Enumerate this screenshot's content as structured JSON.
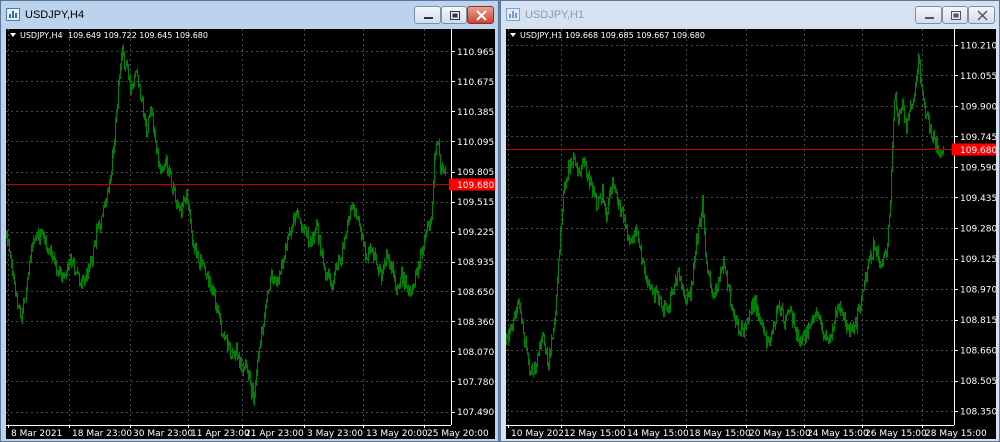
{
  "windows": [
    {
      "title": "USDJPY,H4",
      "active": true
    },
    {
      "title": "USDJPY,H1",
      "active": false
    }
  ],
  "colors": {
    "background": "#000000",
    "candles": "#008000",
    "grid": "#4d4d4d",
    "price_line": "#c00000",
    "price_label": "#ff0000",
    "text": "#ffffff"
  },
  "icons": [
    "chart-window-icon",
    "minimize-icon",
    "maximize-icon",
    "close-icon",
    "dropdown-triangle-icon"
  ],
  "chart_data": [
    {
      "type": "candlestick",
      "symbol_label": "USDJPY,H4",
      "ohlc_label": "109.649 109.722 109.645 109.680",
      "yticks": [
        "110.965",
        "110.675",
        "110.385",
        "110.095",
        "109.805",
        "109.515",
        "109.225",
        "108.935",
        "108.650",
        "108.360",
        "108.070",
        "107.780",
        "107.490"
      ],
      "ytick_values": [
        110.965,
        110.675,
        110.385,
        110.095,
        109.805,
        109.515,
        109.225,
        108.935,
        108.65,
        108.36,
        108.07,
        107.78,
        107.49
      ],
      "xticks": [
        "8 Mar 2021",
        "18 Mar 23:00",
        "30 Mar 23:00",
        "11 Apr 23:00",
        "21 Apr 23:00",
        "3 May 23:00",
        "13 May 20:00",
        "25 May 20:00"
      ],
      "current_price": 109.68,
      "current_price_label": "109.680",
      "price_path": [
        [
          0,
          109.2
        ],
        [
          5,
          108.9
        ],
        [
          10,
          108.6
        ],
        [
          15,
          108.4
        ],
        [
          20,
          108.7
        ],
        [
          25,
          109.1
        ],
        [
          35,
          109.2
        ],
        [
          45,
          109.0
        ],
        [
          55,
          108.8
        ],
        [
          65,
          108.95
        ],
        [
          75,
          108.7
        ],
        [
          85,
          108.9
        ],
        [
          90,
          109.2
        ],
        [
          100,
          109.5
        ],
        [
          105,
          109.8
        ],
        [
          110,
          110.4
        ],
        [
          113,
          110.7
        ],
        [
          116,
          110.95
        ],
        [
          120,
          110.8
        ],
        [
          125,
          110.6
        ],
        [
          130,
          110.8
        ],
        [
          135,
          110.5
        ],
        [
          140,
          110.2
        ],
        [
          145,
          110.4
        ],
        [
          150,
          110.0
        ],
        [
          155,
          109.8
        ],
        [
          160,
          109.9
        ],
        [
          165,
          109.7
        ],
        [
          170,
          109.5
        ],
        [
          175,
          109.4
        ],
        [
          180,
          109.6
        ],
        [
          185,
          109.2
        ],
        [
          190,
          109.0
        ],
        [
          195,
          108.9
        ],
        [
          200,
          108.8
        ],
        [
          205,
          108.7
        ],
        [
          210,
          108.5
        ],
        [
          215,
          108.3
        ],
        [
          220,
          108.2
        ],
        [
          225,
          108.0
        ],
        [
          230,
          108.1
        ],
        [
          235,
          107.9
        ],
        [
          240,
          108.0
        ],
        [
          245,
          107.7
        ],
        [
          248,
          107.6
        ],
        [
          252,
          108.1
        ],
        [
          256,
          108.3
        ],
        [
          260,
          108.6
        ],
        [
          265,
          108.8
        ],
        [
          270,
          108.7
        ],
        [
          275,
          108.9
        ],
        [
          280,
          109.1
        ],
        [
          285,
          109.3
        ],
        [
          290,
          109.4
        ],
        [
          295,
          109.3
        ],
        [
          300,
          109.2
        ],
        [
          305,
          109.1
        ],
        [
          310,
          109.3
        ],
        [
          315,
          109.0
        ],
        [
          320,
          108.8
        ],
        [
          325,
          108.7
        ],
        [
          330,
          108.9
        ],
        [
          335,
          109.0
        ],
        [
          340,
          109.2
        ],
        [
          345,
          109.5
        ],
        [
          350,
          109.4
        ],
        [
          355,
          109.2
        ],
        [
          360,
          109.0
        ],
        [
          365,
          109.1
        ],
        [
          370,
          108.9
        ],
        [
          375,
          108.8
        ],
        [
          380,
          109.0
        ],
        [
          385,
          108.9
        ],
        [
          390,
          108.7
        ],
        [
          395,
          108.8
        ],
        [
          400,
          108.7
        ],
        [
          405,
          108.6
        ],
        [
          410,
          108.8
        ],
        [
          415,
          109.0
        ],
        [
          420,
          109.2
        ],
        [
          425,
          109.4
        ],
        [
          428,
          109.9
        ],
        [
          431,
          110.1
        ],
        [
          434,
          109.85
        ],
        [
          437,
          109.8
        ],
        [
          440,
          109.7
        ]
      ],
      "ylim": [
        107.36,
        111.18
      ]
    },
    {
      "type": "candlestick",
      "symbol_label": "USDJPY,H1",
      "ohlc_label": "109.668 109.685 109.667 109.680",
      "yticks": [
        "110.210",
        "110.055",
        "109.900",
        "109.745",
        "109.590",
        "109.435",
        "109.280",
        "109.125",
        "108.970",
        "108.815",
        "108.660",
        "108.505",
        "108.350"
      ],
      "ytick_values": [
        110.21,
        110.055,
        109.9,
        109.745,
        109.59,
        109.435,
        109.28,
        109.125,
        108.97,
        108.815,
        108.66,
        108.505,
        108.35
      ],
      "xticks": [
        "10 May 2021",
        "12 May 15:00",
        "14 May 15:00",
        "18 May 15:00",
        "20 May 15:00",
        "24 May 15:00",
        "26 May 15:00",
        "28 May 15:00"
      ],
      "current_price": 109.68,
      "current_price_label": "109.680",
      "price_path": [
        [
          0,
          108.7
        ],
        [
          6,
          108.8
        ],
        [
          12,
          108.9
        ],
        [
          18,
          108.7
        ],
        [
          24,
          108.55
        ],
        [
          30,
          108.6
        ],
        [
          36,
          108.75
        ],
        [
          42,
          108.6
        ],
        [
          48,
          108.8
        ],
        [
          52,
          109.1
        ],
        [
          56,
          109.4
        ],
        [
          60,
          109.55
        ],
        [
          64,
          109.6
        ],
        [
          68,
          109.65
        ],
        [
          72,
          109.55
        ],
        [
          78,
          109.6
        ],
        [
          84,
          109.5
        ],
        [
          90,
          109.4
        ],
        [
          96,
          109.45
        ],
        [
          100,
          109.35
        ],
        [
          106,
          109.5
        ],
        [
          112,
          109.4
        ],
        [
          118,
          109.3
        ],
        [
          124,
          109.2
        ],
        [
          130,
          109.25
        ],
        [
          136,
          109.1
        ],
        [
          142,
          109.0
        ],
        [
          148,
          108.95
        ],
        [
          154,
          108.9
        ],
        [
          160,
          108.85
        ],
        [
          166,
          108.95
        ],
        [
          172,
          109.05
        ],
        [
          178,
          108.9
        ],
        [
          184,
          108.95
        ],
        [
          190,
          109.2
        ],
        [
          196,
          109.4
        ],
        [
          200,
          109.1
        ],
        [
          206,
          108.95
        ],
        [
          212,
          109.0
        ],
        [
          218,
          109.1
        ],
        [
          224,
          108.9
        ],
        [
          230,
          108.8
        ],
        [
          236,
          108.75
        ],
        [
          242,
          108.85
        ],
        [
          248,
          108.9
        ],
        [
          254,
          108.8
        ],
        [
          260,
          108.7
        ],
        [
          266,
          108.75
        ],
        [
          272,
          108.9
        ],
        [
          278,
          108.8
        ],
        [
          284,
          108.85
        ],
        [
          290,
          108.75
        ],
        [
          296,
          108.7
        ],
        [
          302,
          108.75
        ],
        [
          308,
          108.85
        ],
        [
          314,
          108.8
        ],
        [
          320,
          108.7
        ],
        [
          326,
          108.75
        ],
        [
          332,
          108.9
        ],
        [
          338,
          108.8
        ],
        [
          344,
          108.75
        ],
        [
          350,
          108.8
        ],
        [
          356,
          108.95
        ],
        [
          362,
          109.1
        ],
        [
          368,
          109.2
        ],
        [
          374,
          109.1
        ],
        [
          380,
          109.15
        ],
        [
          384,
          109.4
        ],
        [
          386,
          109.7
        ],
        [
          388,
          109.95
        ],
        [
          392,
          109.85
        ],
        [
          396,
          109.9
        ],
        [
          400,
          109.8
        ],
        [
          404,
          109.9
        ],
        [
          408,
          109.95
        ],
        [
          412,
          110.15
        ],
        [
          415,
          110.0
        ],
        [
          418,
          109.9
        ],
        [
          422,
          109.8
        ],
        [
          426,
          109.75
        ],
        [
          430,
          109.7
        ],
        [
          434,
          109.65
        ],
        [
          438,
          109.68
        ]
      ],
      "ylim": [
        108.28,
        110.29
      ]
    }
  ]
}
